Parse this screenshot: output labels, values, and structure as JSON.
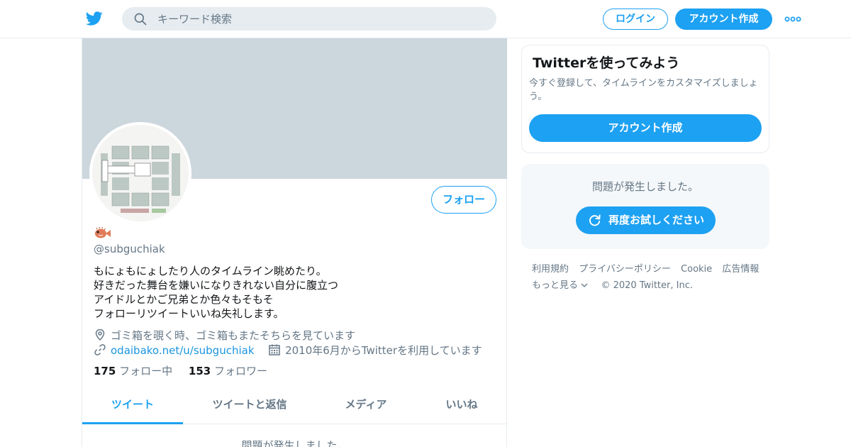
{
  "header": {
    "search_placeholder": "キーワード検索",
    "login_label": "ログイン",
    "signup_label": "アカウント作成"
  },
  "profile": {
    "handle": "@subguchiak",
    "follow_label": "フォロー",
    "bio_lines": [
      "もにょもにょしたり人のタイムライン眺めたり。",
      "好きだった舞台を嫌いになりきれない自分に腹立つ",
      "アイドルとかご兄弟とか色々もそもそ",
      "フォローリツイートいいね失礼します。"
    ],
    "location": "ゴミ箱を覗く時、ゴミ箱もまたそちらを見ています",
    "url": "odaibako.net/u/subguchiak",
    "joined": "2010年6月からTwitterを利用しています",
    "following_count": "175",
    "following_label": "フォロー中",
    "followers_count": "153",
    "followers_label": "フォロワー"
  },
  "tabs": [
    {
      "label": "ツイート",
      "active": true
    },
    {
      "label": "ツイートと返信",
      "active": false
    },
    {
      "label": "メディア",
      "active": false
    },
    {
      "label": "いいね",
      "active": false
    }
  ],
  "timeline_error": "問題が発生しました。",
  "sidebar": {
    "try_title": "Twitterを使ってみよう",
    "try_desc": "今すぐ登録して、タイムラインをカスタマイズしましょう。",
    "try_button": "アカウント作成",
    "error_message": "問題が発生しました。",
    "retry_button": "再度お試しください"
  },
  "footer": {
    "links": [
      "利用規約",
      "プライバシーポリシー",
      "Cookie",
      "広告情報"
    ],
    "more_label": "もっと見る",
    "copyright": "© 2020 Twitter, Inc."
  },
  "colors": {
    "accent": "#1da1f2",
    "banner": "#ccd6dd",
    "muted_text": "#657786",
    "link": "#1b95e0"
  }
}
